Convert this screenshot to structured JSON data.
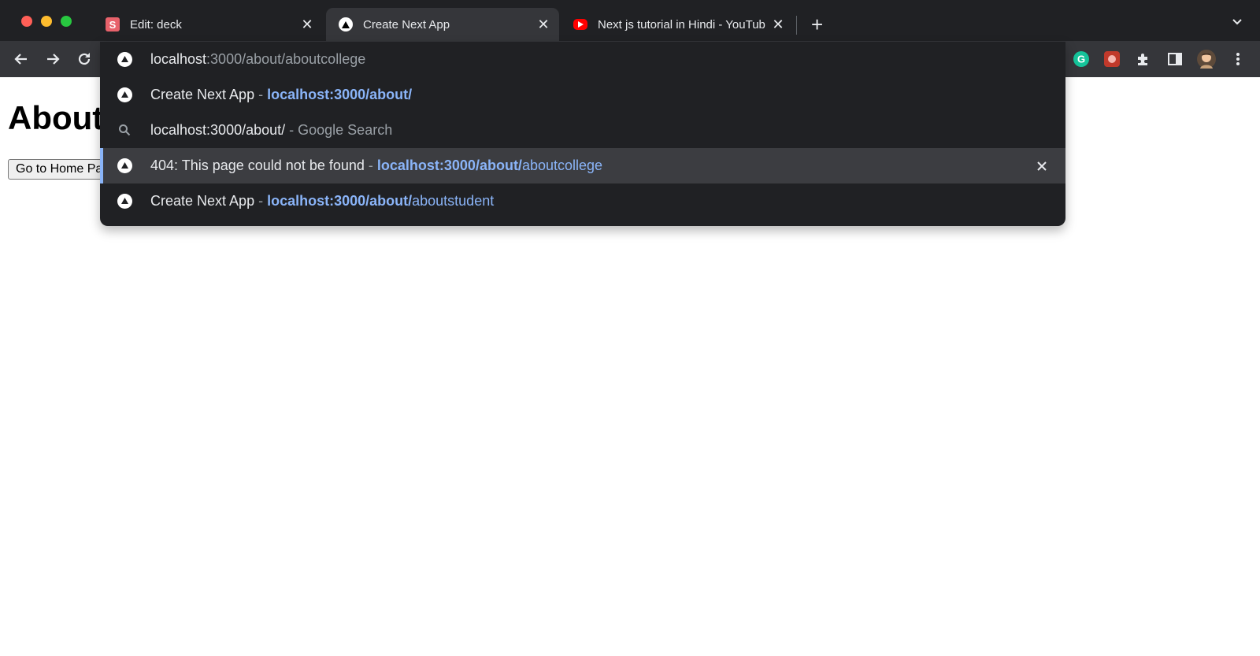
{
  "tabs": [
    {
      "title": "Edit: deck",
      "favicon": "slides-s-icon",
      "favicon_letter": "S",
      "active": false
    },
    {
      "title": "Create Next App",
      "favicon": "nextjs-triangle-icon",
      "active": true
    },
    {
      "title": "Next js tutorial in Hindi - YouTube",
      "favicon": "youtube-icon",
      "active": false
    }
  ],
  "page": {
    "heading": "About",
    "button_label": "Go to Home Page"
  },
  "omnibox": {
    "input": {
      "host": "localhost",
      "rest": ":3000/about/aboutcollege"
    },
    "suggestions": [
      {
        "title": "Create Next App",
        "sep": " - ",
        "url_bold": "localhost:3000/about/",
        "url_rest": ""
      },
      {
        "query": "localhost:3000/about/",
        "suffix": " - Google Search"
      },
      {
        "title": "404: This page could not be found",
        "sep": " - ",
        "url_bold": "localhost:3000/about/",
        "url_rest": "aboutcollege"
      },
      {
        "title": "Create Next App",
        "sep": " - ",
        "url_bold": "localhost:3000/about/",
        "url_rest": "aboutstudent"
      }
    ]
  },
  "colors": {
    "frame": "#202124",
    "toolbar": "#35363a",
    "link": "#8ab4f8",
    "selected_row": "#3c3d41"
  }
}
